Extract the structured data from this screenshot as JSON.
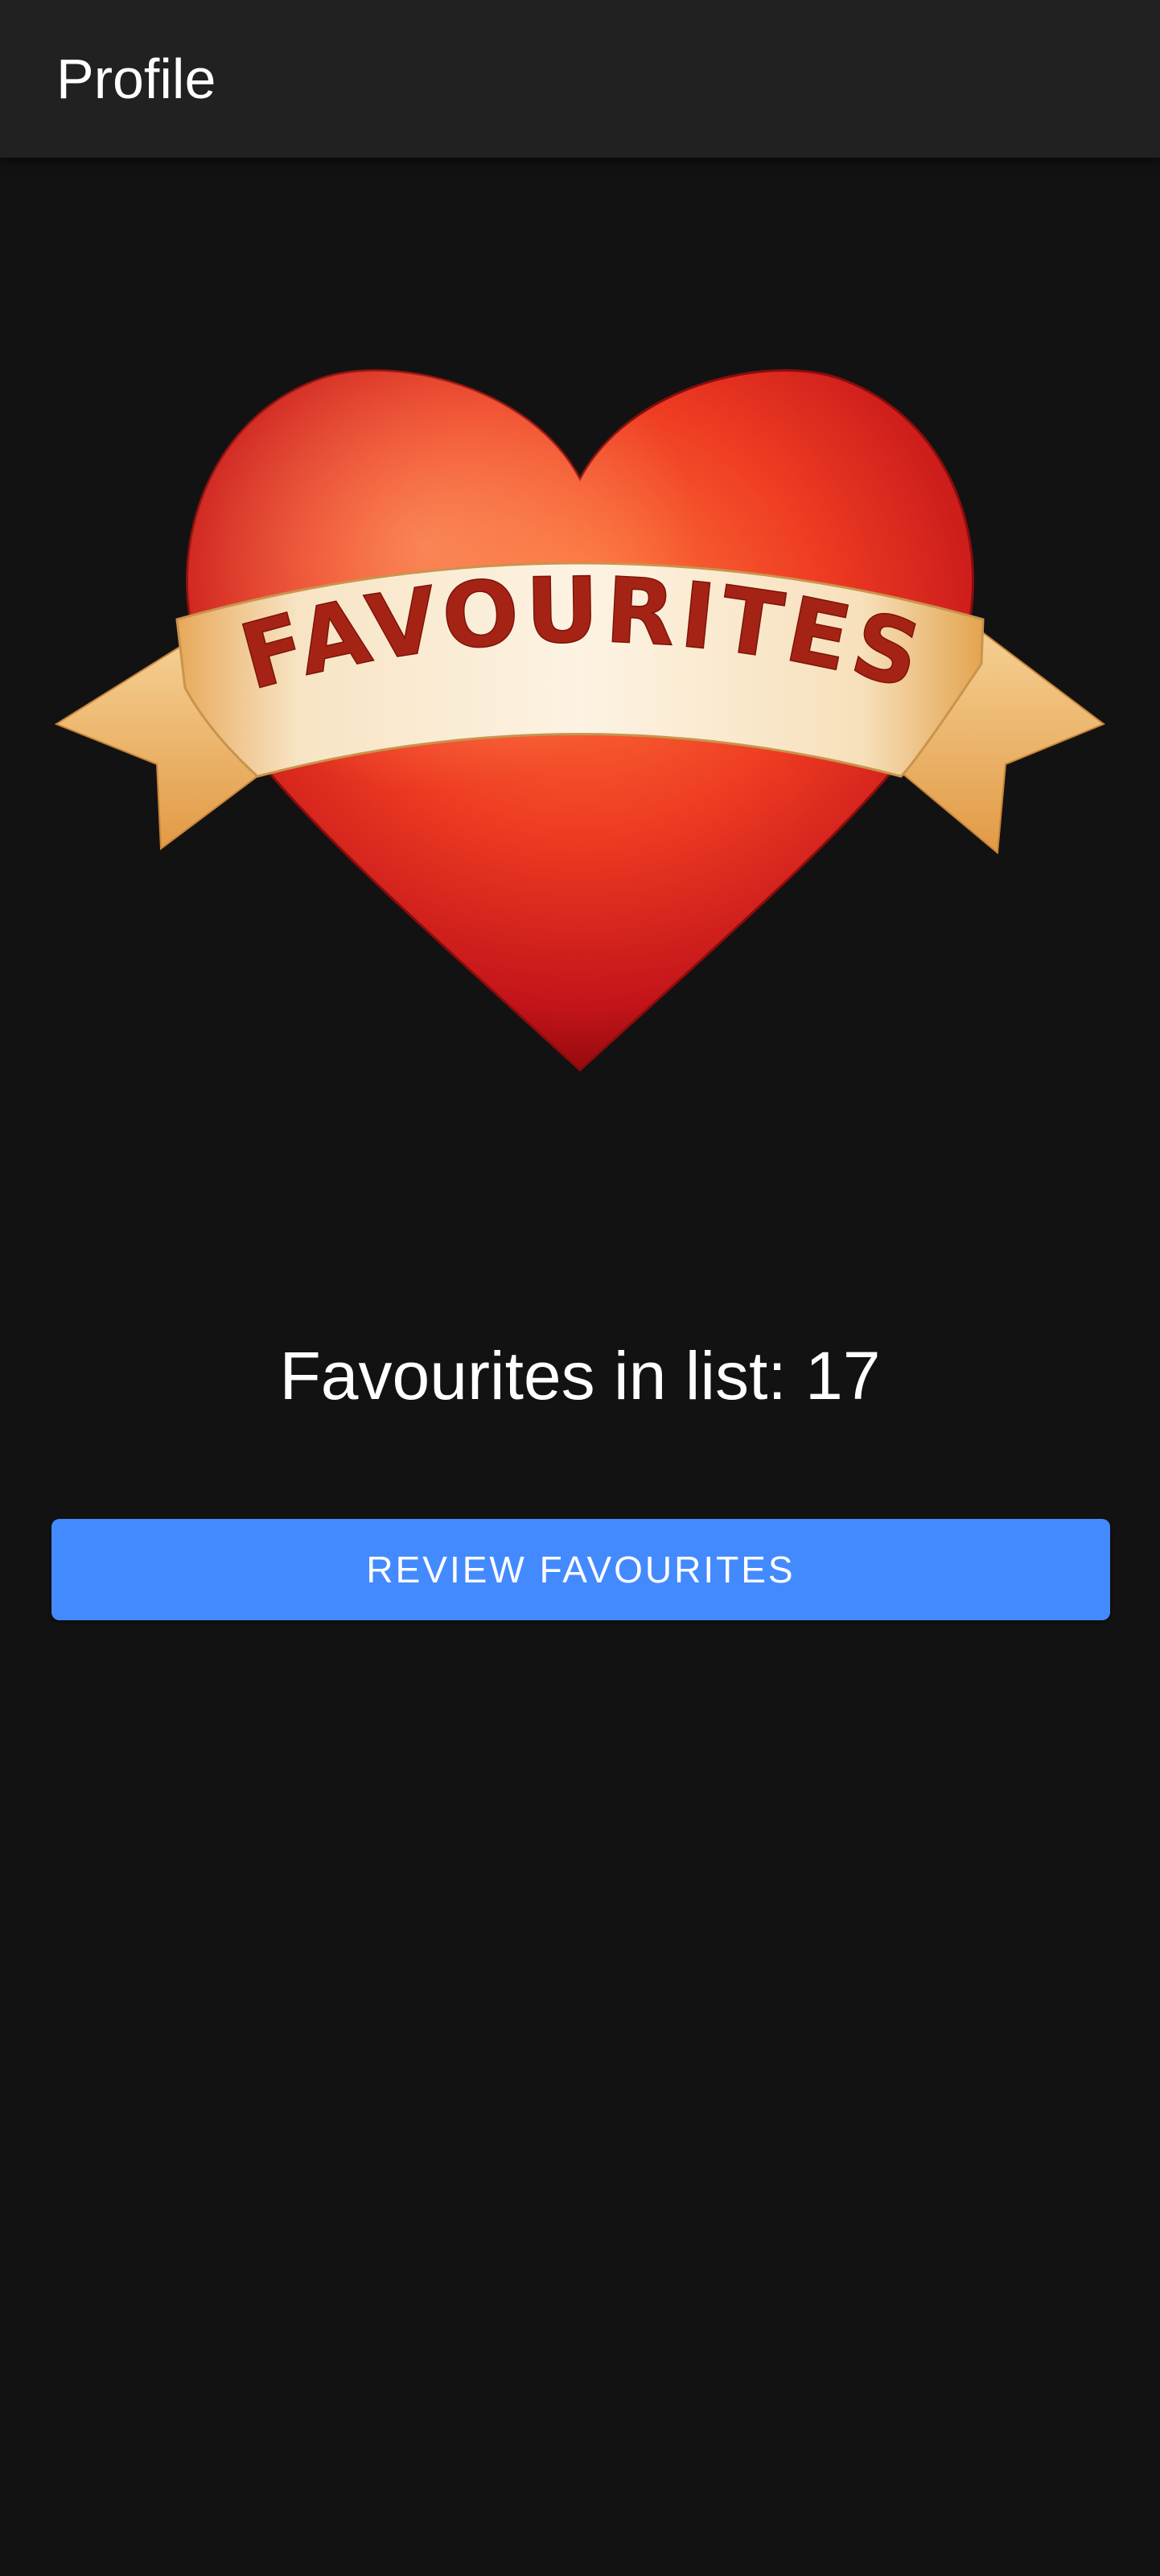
{
  "app_bar": {
    "title": "Profile"
  },
  "emblem": {
    "banner_text": "FAVOURITES",
    "icon": "heart-with-banner-icon",
    "colors": {
      "heart": "#d8231e",
      "banner": "#f6dfb6",
      "banner_text": "#a52315"
    }
  },
  "favourites": {
    "count_text": "Favourites in list: 17",
    "count": 17
  },
  "actions": {
    "review_label": "REVIEW FAVOURITES"
  },
  "theme": {
    "background": "#121212",
    "app_bar": "#212121",
    "accent": "#448aff"
  }
}
